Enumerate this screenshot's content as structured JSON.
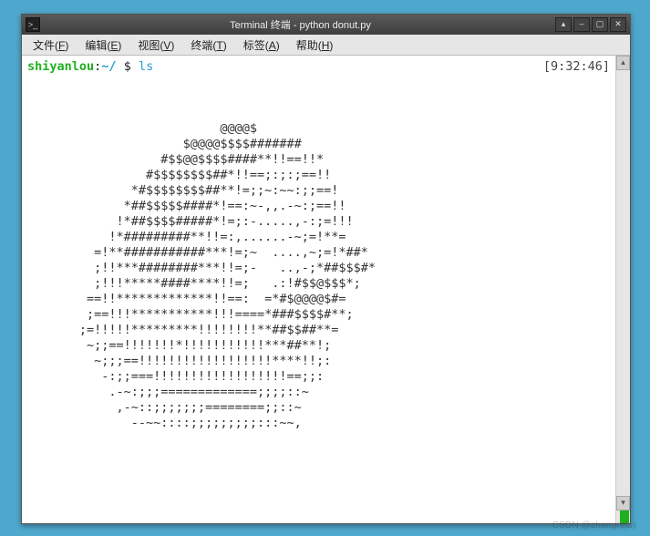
{
  "window": {
    "title": "Terminal 终端 - python donut.py",
    "controls": {
      "shade": "▴",
      "minimize": "–",
      "maximize": "▢",
      "close": "✕"
    }
  },
  "menubar": [
    {
      "label": "文件(F)",
      "underline_idx": 3
    },
    {
      "label": "编辑(E)",
      "underline_idx": 3
    },
    {
      "label": "视图(V)",
      "underline_idx": 3
    },
    {
      "label": "终端(T)",
      "underline_idx": 3
    },
    {
      "label": "标签(A)",
      "underline_idx": 3
    },
    {
      "label": "帮助(H)",
      "underline_idx": 3
    }
  ],
  "prompt": {
    "user": "shiyanlou",
    "sep1": ":",
    "path": "~/",
    "sigil": " $ ",
    "command": "ls",
    "timestamp": "[9:32:46]"
  },
  "ascii_art": [
    "",
    "",
    "",
    "                          @@@@$",
    "                     $@@@@$$$$#######",
    "                  #$$@@$$$$####**!!==!!*",
    "                #$$$$$$$$##*!!==;:;:;==!!",
    "              *#$$$$$$$$##**!=;;~:~~:;;==!",
    "             *##$$$$$####*!==:~-,,.-~:;==!!",
    "            !*##$$$$#####*!=;:-.....,-:;=!!!",
    "           !*#########**!!=:,......-~;=!**=",
    "         =!**###########***!=;~  ....,~;=!*##*",
    "         ;!!***########***!!=;-   ..,-;*##$$$#*",
    "         ;!!!*****####****!!=;   .:!#$$@$$$*;",
    "        ==!!*************!!==:  =*#$@@@@$#=",
    "        ;==!!!***********!!!====*###$$$$#**;",
    "       ;=!!!!!*********!!!!!!!!**##$$##**=",
    "        ~;;==!!!!!!!*!!!!!!!!!!!***##**!;",
    "         ~;;;==!!!!!!!!!!!!!!!!!!****!!;:",
    "          -:;;===!!!!!!!!!!!!!!!!!!==;;:",
    "           .-~:;;;=============;;;;::~",
    "            ,-~::;;;;;;;========;;::~",
    "              --~~::::;;;;;;;;;:::~~,"
  ],
  "watermark": "CSDN @zhangrelay"
}
